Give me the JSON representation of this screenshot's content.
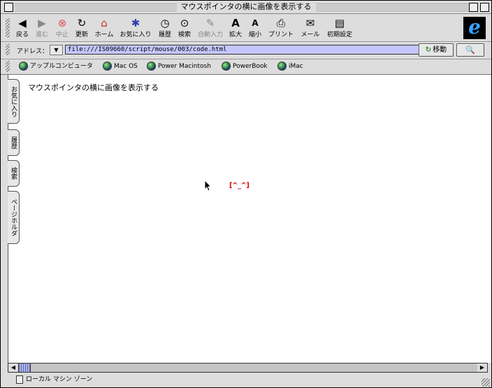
{
  "window": {
    "title": "マウスポインタの横に画像を表示する"
  },
  "toolbar": {
    "buttons": [
      {
        "label": "戻る",
        "icon": "◀"
      },
      {
        "label": "進む",
        "icon": "▶"
      },
      {
        "label": "中止",
        "icon": "⊗"
      },
      {
        "label": "更新",
        "icon": "↻"
      },
      {
        "label": "ホーム",
        "icon": "⌂"
      },
      {
        "label": "お気に入り",
        "icon": "✱"
      },
      {
        "label": "履歴",
        "icon": "◷"
      },
      {
        "label": "検索",
        "icon": "⊙"
      },
      {
        "label": "自動入力",
        "icon": "✎"
      },
      {
        "label": "拡大",
        "icon": "A"
      },
      {
        "label": "縮小",
        "icon": "A"
      },
      {
        "label": "プリント",
        "icon": "⎙"
      },
      {
        "label": "メール",
        "icon": "✉"
      },
      {
        "label": "初期設定",
        "icon": "▤"
      }
    ],
    "logo": "e"
  },
  "address": {
    "label": "アドレス：",
    "url": "file:///IS09660/script/mouse/003/code.html",
    "go_label": "移動",
    "dropdown_icon": "▼",
    "search_icon": "🔍"
  },
  "favorites": [
    {
      "label": "アップルコンピュータ"
    },
    {
      "label": "Mac OS"
    },
    {
      "label": "Power Macintosh"
    },
    {
      "label": "PowerBook"
    },
    {
      "label": "iMac"
    }
  ],
  "sidetabs": [
    "お気に入り",
    "履歴",
    "検索",
    "ページホルダ"
  ],
  "page": {
    "heading": "マウスポインタの横に画像を表示する",
    "cursor_image": "[^_^]"
  },
  "status": {
    "zone": "ローカル マシン ゾーン"
  }
}
